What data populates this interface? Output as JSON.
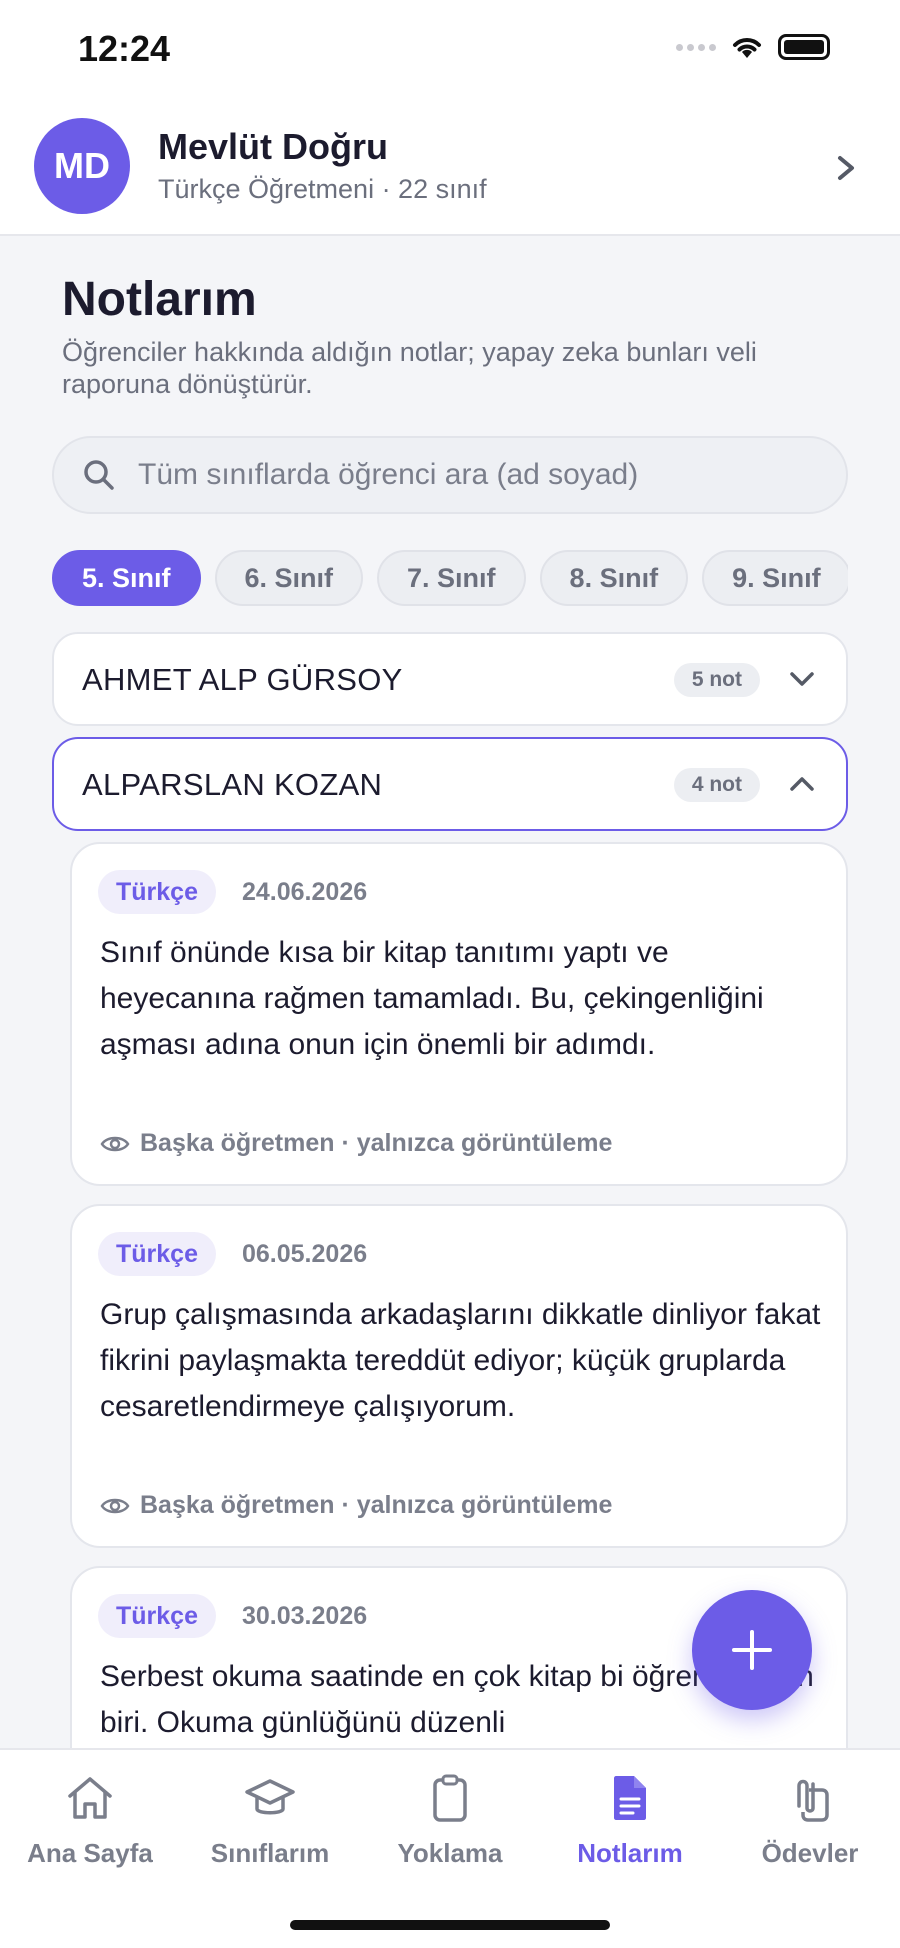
{
  "status_bar": {
    "time": "12:24"
  },
  "profile": {
    "initials": "MD",
    "name": "Mevlüt Doğru",
    "subtitle": "Türkçe Öğretmeni · 22 sınıf"
  },
  "page": {
    "title": "Notlarım",
    "subtitle": "Öğrenciler hakkında aldığın notlar; yapay zeka bunları veli raporuna dönüştürür."
  },
  "search": {
    "placeholder": "Tüm sınıflarda öğrenci ara (ad soyad)",
    "value": ""
  },
  "class_chips": [
    "5. Sınıf",
    "6. Sınıf",
    "7. Sınıf",
    "8. Sınıf",
    "9. Sınıf"
  ],
  "active_class": "5. Sınıf",
  "students": [
    {
      "name": "AHMET ALP GÜRSOY",
      "count": "5 not",
      "expanded": false
    },
    {
      "name": "ALPARSLAN KOZAN",
      "count": "4 not",
      "expanded": true
    }
  ],
  "notes": [
    {
      "subject": "Türkçe",
      "date": "24.06.2026",
      "text": "Sınıf önünde kısa bir kitap tanıtımı yaptı ve heyecanına rağmen tamamladı. Bu, çekingenliğini aşması adına onun için önemli bir adımdı.",
      "visibility": "Başka öğretmen · yalnızca görüntüleme"
    },
    {
      "subject": "Türkçe",
      "date": "06.05.2026",
      "text": "Grup çalışmasında arkadaşlarını dikkatle dinliyor fakat fikrini paylaşmakta tereddüt ediyor; küçük gruplarda cesaretlendirmeye çalışıyorum.",
      "visibility": "Başka öğretmen · yalnızca görüntüleme"
    },
    {
      "subject": "Türkçe",
      "date": "30.03.2026",
      "text": "Serbest okuma saatinde en çok kitap bi öğrencilerden biri. Okuma günlüğünü düzenli"
    }
  ],
  "nav": [
    {
      "label": "Ana Sayfa",
      "icon": "home-icon"
    },
    {
      "label": "Sınıflarım",
      "icon": "graduation-cap-icon"
    },
    {
      "label": "Yoklama",
      "icon": "clipboard-icon"
    },
    {
      "label": "Notlarım",
      "icon": "document-icon",
      "active": true
    },
    {
      "label": "Ödevler",
      "icon": "paperclip-icon"
    }
  ],
  "colors": {
    "accent": "#6c5ce7",
    "text": "#1c1b2e",
    "muted": "#7a7e8b",
    "background": "#f4f5f8"
  }
}
